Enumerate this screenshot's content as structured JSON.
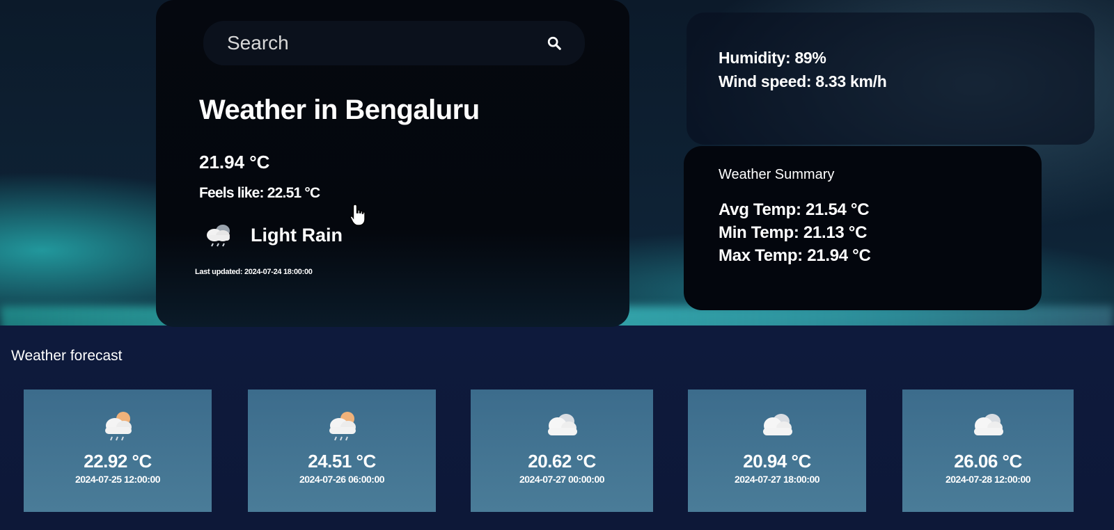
{
  "search": {
    "placeholder": "Search"
  },
  "current": {
    "title": "Weather in Bengaluru",
    "temperature": "21.94 °C",
    "feels_like": "Feels like: 22.51 °C",
    "condition": "Light Rain",
    "condition_icon": "rain-cloud-icon",
    "last_updated": "Last updated: 2024-07-24 18:00:00"
  },
  "details": {
    "humidity": "Humidity: 89%",
    "wind_speed": "Wind speed: 8.33 km/h"
  },
  "summary": {
    "title": "Weather Summary",
    "avg": "Avg Temp: 21.54 °C",
    "min": "Min Temp: 21.13 °C",
    "max": "Max Temp: 21.94 °C"
  },
  "forecast": {
    "heading": "Weather forecast",
    "items": [
      {
        "temp": "22.92 °C",
        "date": "2024-07-25 12:00:00",
        "icon": "sun-rain-cloud-icon"
      },
      {
        "temp": "24.51 °C",
        "date": "2024-07-26 06:00:00",
        "icon": "sun-rain-cloud-icon"
      },
      {
        "temp": "20.62 °C",
        "date": "2024-07-27 00:00:00",
        "icon": "cloud-icon"
      },
      {
        "temp": "20.94 °C",
        "date": "2024-07-27 18:00:00",
        "icon": "cloud-icon"
      },
      {
        "temp": "26.06 °C",
        "date": "2024-07-28 12:00:00",
        "icon": "cloud-icon"
      }
    ]
  }
}
